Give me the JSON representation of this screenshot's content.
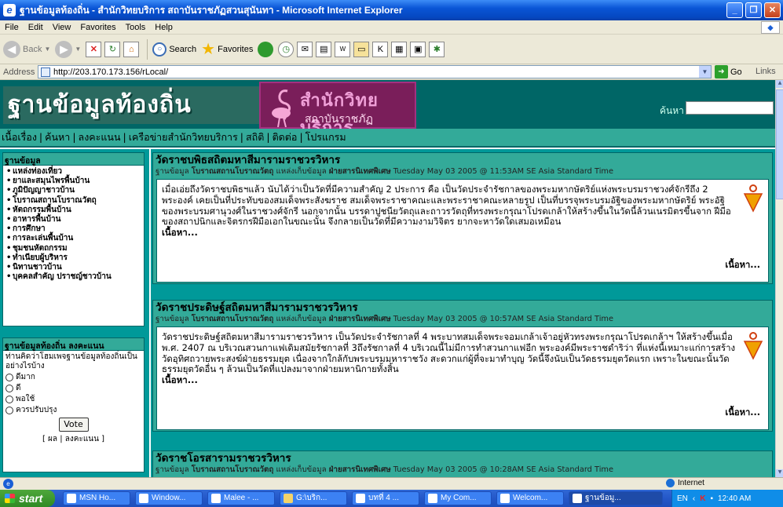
{
  "window": {
    "title": "ฐานข้อมูลท้องถิ่น - สำนักวิทยบริการ สถาบันราชภัฏสวนสุนันทา - Microsoft Internet Explorer"
  },
  "menu": [
    "File",
    "Edit",
    "View",
    "Favorites",
    "Tools",
    "Help"
  ],
  "toolbar": {
    "back": "Back",
    "search": "Search",
    "favorites": "Favorites"
  },
  "address": {
    "label": "Address",
    "url": "http://203.170.173.156/rLocal/",
    "go": "Go",
    "links": "Links"
  },
  "page": {
    "banner_title": "ฐานข้อมูลท้องถิ่น",
    "logo_line1": "สำนักวิทยบริการ",
    "logo_line2": "สถาบันราชภัฏ",
    "search_label": "ค้นหา",
    "nav": [
      "เนื้อเรื่อง",
      "ค้นหา",
      "ลงคะแนน",
      "เครือข่ายสำนักวิทยบริการ",
      "สถิติ",
      "ติดต่อ",
      "โปรแกรม"
    ],
    "sidebar": {
      "db_title": "ฐานข้อมูล",
      "items": [
        "แหล่งท่องเที่ยว",
        "ยาและสมุนไพรพื้นบ้าน",
        "ภูมิปัญญาชาวบ้าน",
        "โบราณสถานโบราณวัตถุ",
        "หัตถกรรมพื้นบ้าน",
        "อาหารพื้นบ้าน",
        "การศึกษา",
        "การละเล่นพื้นบ้าน",
        "ชุมชนหัตถกรรม",
        "ทำเนียบผู้บริหาร",
        "นิทานชาวบ้าน",
        "บุคคลสำคัญ ปราชญ์ชาวบ้าน"
      ],
      "poll_title": "ฐานข้อมูลท้องถิ่น ลงคะแนน",
      "poll_question": "ท่านคิดว่าโฮมเพจฐานข้อมูลท้องถิ่นเป็นอย่างไรบ้าง",
      "poll_options": [
        "ดีมาก",
        "ดี",
        "พอใช้",
        "ควรปรับปรุง"
      ],
      "vote": "Vote",
      "poll_links": "[ ผล | ลงคะแนน ]"
    },
    "articles": [
      {
        "title": "วัดราชบพิธสถิตมหาสีมารามราชวรวิหาร",
        "meta_db_label": "ฐานข้อมูล",
        "meta_db": "โบราณสถานโบราณวัตถุ",
        "meta_src_label": "แหล่งเก็บข้อมูล",
        "meta_src": "ฝ่ายสารนิเทศพิเศษ",
        "date": "Tuesday May 03 2005 @ 11:53AM SE Asia Standard Time",
        "body": "เมื่อเอ่ยถึงวัดราชบพิธฯแล้ว นับได้ว่าเป็นวัดที่มีความสำคัญ 2 ประการ คือ เป็นวัดประจำรัชกาลของพระมหากษัตริย์แห่งพระบรมราชวงศ์จักรีถึง 2 พระองค์ เคยเป็นที่ประทับของสมเด็จพระสังฆราช สมเด็จพระราชาคณะและพระราชาคณะหลายรูป เป็นที่บรรจุพระบรมอัฐิของพระมหากษัตริย์ พระอัฐิของพระบรมศานุวงศ์ในราชวงศ์จักรี นอกจากนั้น บรรดาปูชนียวัตถุและถาวรวัตถุที่ทรงพระกรุณาโปรดเกล้าให้สร้างขึ้นในวัดนี้ล้วนเนรมิตรขึ้นจาก ฝีมือของสถาปนิกและจิตรกรฝีมือเอกในขณะนั้น จึงกลายเป็นวัดที่มีความงามวิจิตร ยากจะหาวัดใดเสมอเหมือน",
        "more_inline": "เนื้อหา...",
        "more_right": "เนื้อหา..."
      },
      {
        "title": "วัดราชประดิษฐ์สถิตมหาสีมารามราชวรวิหาร",
        "meta_db_label": "ฐานข้อมูล",
        "meta_db": "โบราณสถานโบราณวัตถุ",
        "meta_src_label": "แหล่งเก็บข้อมูล",
        "meta_src": "ฝ่ายสารนิเทศพิเศษ",
        "date": "Tuesday May 03 2005 @ 10:57AM SE Asia Standard Time",
        "body": "วัดราชประดิษฐ์สถิตมหาสีมารามราชวรวิหาร เป็นวัดประจำรัชกาลที่ 4 พระบาทสมเด็จพระจอมเกล้าเจ้าอยู่หัวทรงพระกรุณาโปรดเกล้าฯ ให้สร้างขึ้นเมื่อ พ.ศ. 2407 ณ บริเวณสวนกาแฟเดิมสมัยรัชกาลที่ 3ถึงรัชกาลที่ 4 บริเวณนี้ไม่มีการทำสวนกาแฟอีก พระองค์มีพระราชดำริว่า ที่แห่งนี้เหมาะแก่การสร้างวัดอุทิศถวายพระสงฆ์ฝ่ายธรรมยุต เนื่องจากใกล้กับพระบรมมหาราชวัง สะดวกแก่ผู้ที่จะมาทำบุญ วัดนี้จึงนับเป็นวัดธรรมยุตวัดแรก เพราะในขณะนั้นวัดธรรมยุตวัดอื่น ๆ ล้วนเป็นวัดที่แปลงมาจากฝ่ายมหานิกายทั้งสิ้น",
        "more_inline": "เนื้อหา...",
        "more_right": "เนื้อหา..."
      },
      {
        "title": "วัดราชโอรสารามราชวรวิหาร",
        "meta_db_label": "ฐานข้อมูล",
        "meta_db": "โบราณสถานโบราณวัตถุ",
        "meta_src_label": "แหล่งเก็บข้อมูล",
        "meta_src": "ฝ่ายสารนิเทศพิเศษ",
        "date": "Tuesday May 03 2005 @ 10:28AM SE Asia Standard Time"
      }
    ]
  },
  "status": {
    "zone": "Internet"
  },
  "taskbar": {
    "start": "start",
    "tasks": [
      "MSN Ho...",
      "Window...",
      "Malee - ...",
      "G:\\บริก...",
      "บทที่ 4 ...",
      "My Com...",
      "Welcom...",
      "ฐานข้อมู..."
    ],
    "lang": "EN",
    "time": "12:40 AM"
  }
}
